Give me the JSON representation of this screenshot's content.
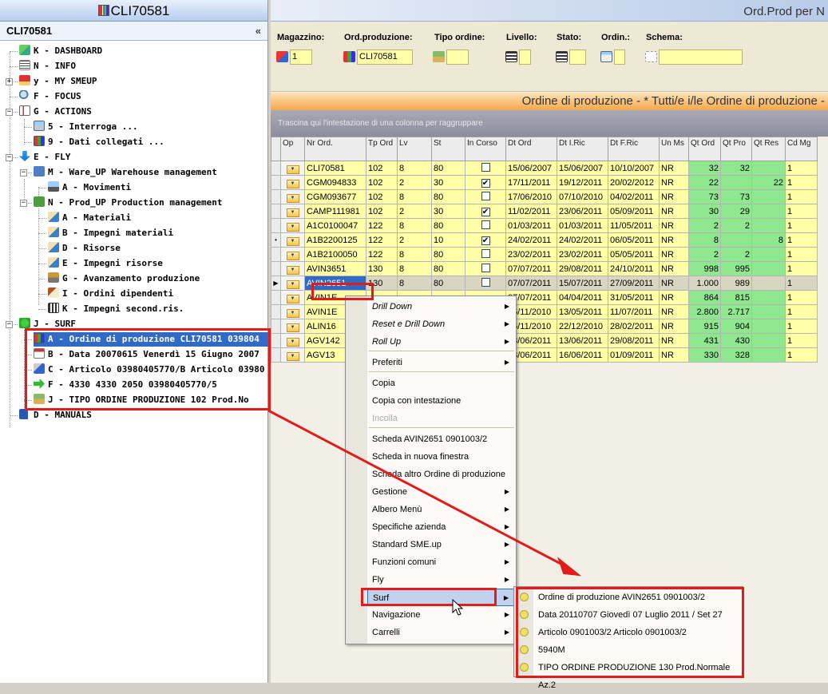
{
  "left_panel": {
    "window_title": "CLI70581",
    "header": "CLI70581",
    "collapse_glyph": "«",
    "tree": [
      {
        "label": "K - DASHBOARD",
        "icon": "dashboard-icon"
      },
      {
        "label": "N - INFO",
        "icon": "list-icon"
      },
      {
        "label": "y - MY SMEUP",
        "icon": "factory-icon"
      },
      {
        "label": "F - FOCUS",
        "icon": "magnifier-icon"
      },
      {
        "label": "G - ACTIONS",
        "icon": "checklist-icon"
      },
      {
        "label": "5 - Interroga ...",
        "icon": "window-icon"
      },
      {
        "label": "9 - Dati collegati ...",
        "icon": "grid-icon"
      },
      {
        "label": "E - FLY",
        "icon": "arrow-down-icon"
      },
      {
        "label": "M - Ware_UP Warehouse management",
        "icon": "gm-icon"
      },
      {
        "label": "A - Movimenti",
        "icon": "truck-icon"
      },
      {
        "label": "N - Prod_UP Production management",
        "icon": "ps-icon"
      },
      {
        "label": "A - Materiali",
        "icon": "materials-icon"
      },
      {
        "label": "B - Impegni materiali",
        "icon": "materials-icon"
      },
      {
        "label": "D - Risorse",
        "icon": "materials-icon"
      },
      {
        "label": "E - Impegni risorse",
        "icon": "materials-icon"
      },
      {
        "label": "G - Avanzamento produzione",
        "icon": "production-icon"
      },
      {
        "label": "I - Ordini dipendenti",
        "icon": "orders-icon"
      },
      {
        "label": "K - Impegni second.ris.",
        "icon": "calculator-icon"
      },
      {
        "label": "J - SURF",
        "icon": "surf-icon"
      },
      {
        "label": "A - Ordine di produzione CLI70581 039804",
        "icon": "grid-icon"
      },
      {
        "label": "B - Data 20070615 Venerdì 15 Giugno 2007",
        "icon": "calendar-icon"
      },
      {
        "label": "C - Articolo 03980405770/B Articolo 03980",
        "icon": "article-icon"
      },
      {
        "label": "F - 4330 4330 2050 03980405770/5",
        "icon": "arrow-right-icon"
      },
      {
        "label": "J - TIPO ORDINE PRODUZIONE 102 Prod.No",
        "icon": "type-icon"
      },
      {
        "label": "D - MANUALS",
        "icon": "book-icon"
      }
    ]
  },
  "right_panel": {
    "title": "Ord.Prod per N",
    "filters": {
      "magazzino": {
        "label": "Magazzino:",
        "value": "1"
      },
      "ord_produzione": {
        "label": "Ord.produzione:",
        "value": "CLI70581"
      },
      "tipo_ordine": {
        "label": "Tipo ordine:",
        "value": ""
      },
      "livello": {
        "label": "Livello:",
        "value": ""
      },
      "stato": {
        "label": "Stato:",
        "value": ""
      },
      "ordin": {
        "label": "Ordin.:",
        "value": ""
      },
      "schema": {
        "label": "Schema:",
        "value": ""
      }
    },
    "grid_title": "Ordine di produzione - * Tutti/e i/le Ordine di produzione -",
    "group_hint": "Trascina qui l'intestazione di una colonna per raggruppare",
    "columns": [
      "Op",
      "Nr Ord.",
      "Tp Ord",
      "Lv",
      "St",
      "In Corso",
      "Dt Ord",
      "Dt I.Ric",
      "Dt F.Ric",
      "Un Ms",
      "Qt Ord",
      "Qt Pro",
      "Qt Res",
      "Cd Mg"
    ],
    "rows": [
      {
        "nr": "CLI70581",
        "tp": "102",
        "lv": "8",
        "st": "80",
        "incorso": false,
        "dtord": "15/06/2007",
        "dtiric": "15/06/2007",
        "dtfric": "10/10/2007",
        "ums": "NR",
        "qtord": "32",
        "qtpro": "32",
        "qtres": "",
        "cdmg": "1",
        "marker": ""
      },
      {
        "nr": "CGM094833",
        "tp": "102",
        "lv": "2",
        "st": "30",
        "incorso": true,
        "dtord": "17/11/2011",
        "dtiric": "19/12/2011",
        "dtfric": "20/02/2012",
        "ums": "NR",
        "qtord": "22",
        "qtpro": "",
        "qtres": "22",
        "cdmg": "1",
        "marker": ""
      },
      {
        "nr": "CGM093677",
        "tp": "102",
        "lv": "8",
        "st": "80",
        "incorso": false,
        "dtord": "17/06/2010",
        "dtiric": "07/10/2010",
        "dtfric": "04/02/2011",
        "ums": "NR",
        "qtord": "73",
        "qtpro": "73",
        "qtres": "",
        "cdmg": "1",
        "marker": ""
      },
      {
        "nr": "CAMP111981",
        "tp": "102",
        "lv": "2",
        "st": "30",
        "incorso": true,
        "dtord": "11/02/2011",
        "dtiric": "23/06/2011",
        "dtfric": "05/09/2011",
        "ums": "NR",
        "qtord": "30",
        "qtpro": "29",
        "qtres": "",
        "cdmg": "1",
        "marker": ""
      },
      {
        "nr": "A1C0100047",
        "tp": "122",
        "lv": "8",
        "st": "80",
        "incorso": false,
        "dtord": "01/03/2011",
        "dtiric": "01/03/2011",
        "dtfric": "11/05/2011",
        "ums": "NR",
        "qtord": "2",
        "qtpro": "2",
        "qtres": "",
        "cdmg": "1",
        "marker": ""
      },
      {
        "nr": "A1B2200125",
        "tp": "122",
        "lv": "2",
        "st": "10",
        "incorso": true,
        "dtord": "24/02/2011",
        "dtiric": "24/02/2011",
        "dtfric": "06/05/2011",
        "ums": "NR",
        "qtord": "8",
        "qtpro": "",
        "qtres": "8",
        "cdmg": "1",
        "marker": "•"
      },
      {
        "nr": "A1B2100050",
        "tp": "122",
        "lv": "8",
        "st": "80",
        "incorso": false,
        "dtord": "23/02/2011",
        "dtiric": "23/02/2011",
        "dtfric": "05/05/2011",
        "ums": "NR",
        "qtord": "2",
        "qtpro": "2",
        "qtres": "",
        "cdmg": "1",
        "marker": ""
      },
      {
        "nr": "AVIN3651",
        "tp": "130",
        "lv": "8",
        "st": "80",
        "incorso": false,
        "dtord": "07/07/2011",
        "dtiric": "29/08/2011",
        "dtfric": "24/10/2011",
        "ums": "NR",
        "qtord": "998",
        "qtpro": "995",
        "qtres": "",
        "cdmg": "1",
        "marker": ""
      },
      {
        "nr": "AVIN2651",
        "tp": "130",
        "lv": "8",
        "st": "80",
        "incorso": false,
        "dtord": "07/07/2011",
        "dtiric": "15/07/2011",
        "dtfric": "27/09/2011",
        "ums": "NR",
        "qtord": "1.000",
        "qtpro": "989",
        "qtres": "",
        "cdmg": "1",
        "marker": "▶",
        "selected": true
      },
      {
        "nr": "AVIN1E",
        "tp": "",
        "lv": "",
        "st": "",
        "incorso": null,
        "dtord": "07/07/2011",
        "dtiric": "04/04/2011",
        "dtfric": "31/05/2011",
        "ums": "NR",
        "qtord": "864",
        "qtpro": "815",
        "qtres": "",
        "cdmg": "1",
        "marker": ""
      },
      {
        "nr": "AVIN1E",
        "tp": "",
        "lv": "",
        "st": "",
        "incorso": null,
        "dtord": "06/11/2010",
        "dtiric": "13/05/2011",
        "dtfric": "11/07/2011",
        "ums": "NR",
        "qtord": "2.800",
        "qtpro": "2.717",
        "qtres": "",
        "cdmg": "1",
        "marker": ""
      },
      {
        "nr": "ALIN16",
        "tp": "",
        "lv": "",
        "st": "",
        "incorso": null,
        "dtord": "06/11/2010",
        "dtiric": "22/12/2010",
        "dtfric": "28/02/2011",
        "ums": "NR",
        "qtord": "915",
        "qtpro": "904",
        "qtres": "",
        "cdmg": "1",
        "marker": ""
      },
      {
        "nr": "AGV142",
        "tp": "",
        "lv": "",
        "st": "",
        "incorso": null,
        "dtord": "28/06/2011",
        "dtiric": "13/06/2011",
        "dtfric": "29/08/2011",
        "ums": "NR",
        "qtord": "431",
        "qtpro": "430",
        "qtres": "",
        "cdmg": "1",
        "marker": ""
      },
      {
        "nr": "AGV13",
        "tp": "",
        "lv": "",
        "st": "",
        "incorso": null,
        "dtord": "28/06/2011",
        "dtiric": "16/06/2011",
        "dtfric": "01/09/2011",
        "ums": "NR",
        "qtord": "330",
        "qtpro": "328",
        "qtres": "",
        "cdmg": "1",
        "marker": ""
      }
    ]
  },
  "context_menu": {
    "items": [
      {
        "label": "Drill Down",
        "submenu": true,
        "italic": true
      },
      {
        "label": "Reset e Drill Down",
        "submenu": true,
        "italic": true
      },
      {
        "label": "Roll Up",
        "submenu": true,
        "italic": true
      },
      {
        "label": "Preferiti",
        "submenu": true
      },
      {
        "label": "Copia",
        "submenu": false
      },
      {
        "label": "Copia con intestazione",
        "submenu": false
      },
      {
        "label": "Incolla",
        "submenu": false,
        "disabled": true
      },
      {
        "label": "Scheda AVIN2651 0901003/2",
        "submenu": false
      },
      {
        "label": "Scheda in nuova finestra",
        "submenu": false
      },
      {
        "label": "Scheda altro Ordine di produzione",
        "submenu": false
      },
      {
        "label": "Gestione",
        "submenu": true
      },
      {
        "label": "Albero Menù",
        "submenu": true
      },
      {
        "label": "Specifiche azienda",
        "submenu": true
      },
      {
        "label": "Standard SME.up",
        "submenu": true
      },
      {
        "label": "Funzioni comuni",
        "submenu": true
      },
      {
        "label": "Fly",
        "submenu": true
      },
      {
        "label": "Surf",
        "submenu": true,
        "highlighted": true
      },
      {
        "label": "Navigazione",
        "submenu": true
      },
      {
        "label": "Carrelli",
        "submenu": true
      }
    ]
  },
  "surf_submenu": {
    "items": [
      "Ordine di produzione AVIN2651 0901003/2",
      "Data 20110707 Giovedì 07 Luglio 2011 / Set 27",
      "Articolo 0901003/2 Articolo 0901003/2",
      "5940M",
      "TIPO ORDINE PRODUZIONE 130 Prod.Normale Az.2"
    ]
  },
  "colors": {
    "highlight": "#e21b1b",
    "selection": "#316ac5",
    "field_bg": "#ffffa8",
    "qty_bg": "#8fe88f"
  }
}
